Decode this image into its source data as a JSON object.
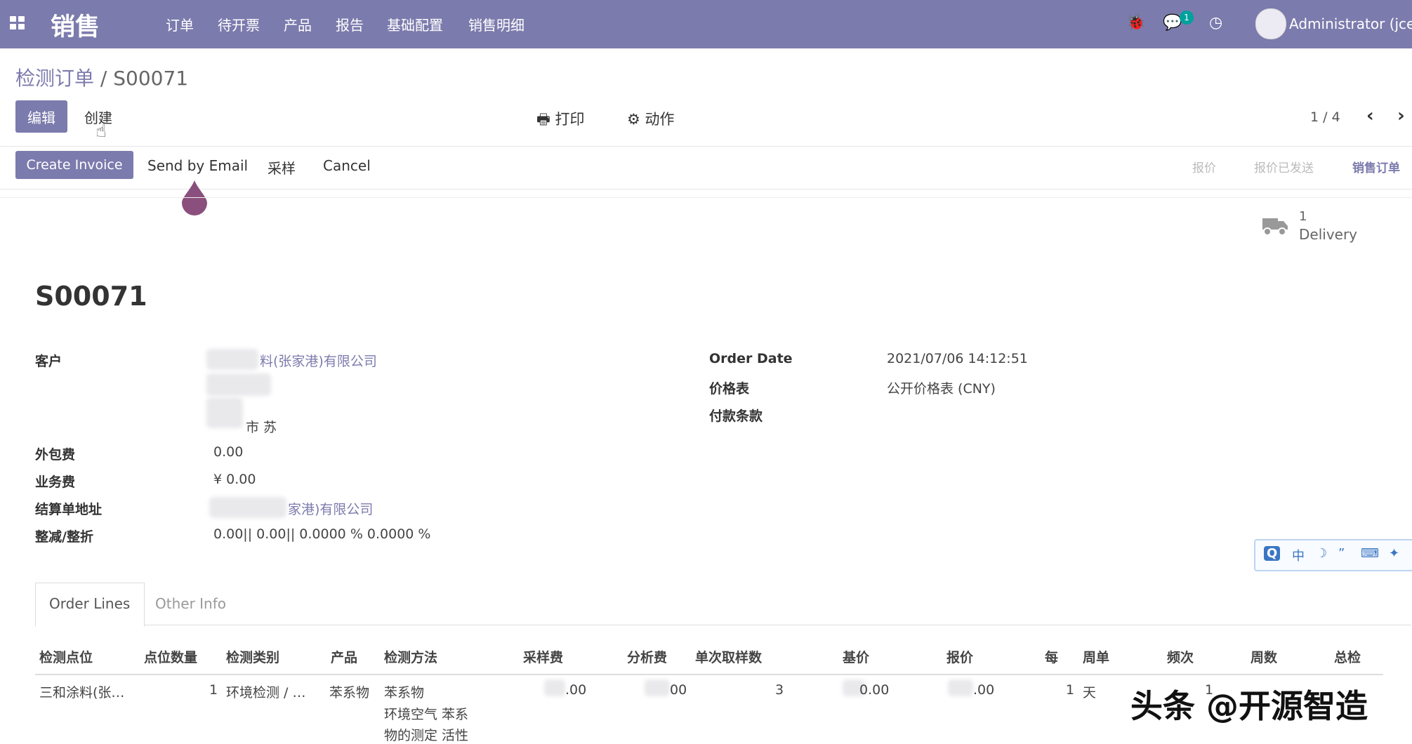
{
  "topbar": {
    "brand": "销售",
    "menu": [
      "订单",
      "待开票",
      "产品",
      "报告",
      "基础配置",
      "销售明细"
    ],
    "notification_count": "1",
    "user": "Administrator (jcerp"
  },
  "breadcrumb": {
    "parent": "检测订单",
    "separator": "/",
    "current": "S00071"
  },
  "toolbar": {
    "edit_label": "编辑",
    "create_label": "创建",
    "print_label": "打印",
    "action_label": "动作",
    "pager": "1 / 4"
  },
  "status_actions": {
    "create_invoice": "Create Invoice",
    "send_email": "Send by Email",
    "sample": "采样",
    "cancel": "Cancel"
  },
  "stages": [
    "报价",
    "报价已发送",
    "销售订单"
  ],
  "delivery": {
    "count": "1",
    "label": "Delivery"
  },
  "order": {
    "name": "S00071",
    "customer_label": "客户",
    "customer_value": "料(张家港)有限公司",
    "customer_address_tail": "市 苏",
    "outsourcing_label": "外包费",
    "outsourcing_value": "0.00",
    "business_label": "业务费",
    "business_value": "¥ 0.00",
    "billing_label": "结算单地址",
    "billing_value": "家港)有限公司",
    "discount_label": "整减/整折",
    "discount_value": "0.00|| 0.00|| 0.0000 % 0.0000 %",
    "order_date_label": "Order Date",
    "order_date_value": "2021/07/06 14:12:51",
    "pricelist_label": "价格表",
    "pricelist_value": "公开价格表 (CNY)",
    "payment_terms_label": "付款条款"
  },
  "tabs": [
    "Order Lines",
    "Other Info"
  ],
  "columns": [
    "检测点位",
    "点位数量",
    "检测类别",
    "产品",
    "检测方法",
    "采样费",
    "分析费",
    "单次取样数",
    "基价",
    "报价",
    "每",
    "周单",
    "频次",
    "周数",
    "总检"
  ],
  "row": {
    "point": "三和涂料(张…",
    "quantity": "1",
    "category": "环境检测 / …",
    "product": "苯系物",
    "method_line1": "苯系物",
    "method_line2": "环境空气 苯系",
    "method_line3": "物的测定 活性",
    "sampling_fee": ".00",
    "analysis_fee": "00",
    "samples": "3",
    "base_price": "0.00",
    "quote": ".00",
    "per": "1",
    "unit": "天",
    "frequency": "1"
  },
  "ime": {
    "logo": "Q",
    "mode": "中"
  },
  "watermark": "头条 @开源智造",
  "colors": {
    "primary": "#7c7bad",
    "drop": "#8a4f7d"
  }
}
